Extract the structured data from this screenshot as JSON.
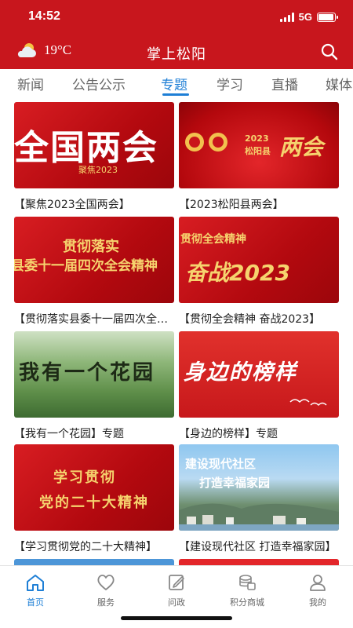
{
  "status_bar": {
    "time": "14:52",
    "network": "5G",
    "battery_level": 0.95
  },
  "app_bar": {
    "weather_icon": "cloud-sun-icon",
    "temperature": "19°C",
    "title": "掌上松阳",
    "search_icon": "search-icon"
  },
  "tabs": [
    {
      "label": "新闻",
      "active": false
    },
    {
      "label": "公告公示",
      "active": false
    },
    {
      "label": "专题",
      "active": true
    },
    {
      "label": "学习",
      "active": false
    },
    {
      "label": "直播",
      "active": false
    },
    {
      "label": "媒体",
      "active": false
    }
  ],
  "cards": [
    {
      "caption": "【聚焦2023全国两会】",
      "thumb_text": [
        "全国两会",
        "聚焦2023"
      ]
    },
    {
      "caption": "【2023松阳县两会】",
      "thumb_text": [
        "2023",
        "松阳县",
        "两会"
      ]
    },
    {
      "caption": "【贯彻落实县委十一届四次全会精神】",
      "thumb_text": [
        "贯彻落实",
        "县委十一届四次全会精神"
      ]
    },
    {
      "caption": "【贯彻全会精神 奋战2023】",
      "thumb_text": [
        "贯彻全会精神",
        "奋战2023"
      ]
    },
    {
      "caption": "【我有一个花园】专题",
      "thumb_text": [
        "我有一个花园"
      ]
    },
    {
      "caption": "【身边的榜样】专题",
      "thumb_text": [
        "身边的榜样"
      ]
    },
    {
      "caption": "【学习贯彻党的二十大精神】",
      "thumb_text": [
        "学习贯彻",
        "党的二十大精神"
      ]
    },
    {
      "caption": "【建设现代社区 打造幸福家园】",
      "thumb_text": [
        "建设现代社区",
        "打造幸福家园"
      ]
    }
  ],
  "bottom_nav": [
    {
      "label": "首页",
      "icon": "home-icon",
      "active": true
    },
    {
      "label": "服务",
      "icon": "heart-icon",
      "active": false
    },
    {
      "label": "问政",
      "icon": "edit-icon",
      "active": false
    },
    {
      "label": "积分商城",
      "icon": "coins-icon",
      "active": false
    },
    {
      "label": "我的",
      "icon": "user-icon",
      "active": false
    }
  ],
  "colors": {
    "brand_red": "#c8161d",
    "accent_blue": "#1e7fd6"
  }
}
